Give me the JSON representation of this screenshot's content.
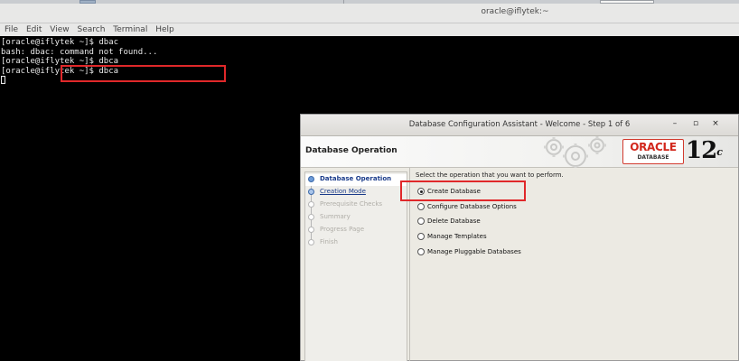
{
  "terminal": {
    "window_title": "oracle@iflytek:~",
    "menu": [
      "File",
      "Edit",
      "View",
      "Search",
      "Terminal",
      "Help"
    ],
    "lines": [
      "[oracle@iflytek ~]$ dbac",
      "bash: dbac: command not found...",
      "[oracle@iflytek ~]$ dbca",
      "[oracle@iflytek ~]$ dbca"
    ]
  },
  "dialog": {
    "title": "Database Configuration Assistant - Welcome - Step 1 of 6",
    "minimize": "–",
    "maximize": "▫",
    "close": "×",
    "banner_title": "Database Operation",
    "logo": {
      "brand": "ORACLE",
      "sub": "DATABASE",
      "version": "12",
      "version_suffix": "c"
    },
    "steps": [
      {
        "label": "Database Operation",
        "state": "active"
      },
      {
        "label": "Creation Mode",
        "state": "link"
      },
      {
        "label": "Prerequisite Checks",
        "state": "disabled"
      },
      {
        "label": "Summary",
        "state": "disabled"
      },
      {
        "label": "Progress Page",
        "state": "disabled"
      },
      {
        "label": "Finish",
        "state": "disabled"
      }
    ],
    "prompt": "Select the operation that you want to perform.",
    "options": [
      {
        "label": "Create Database",
        "selected": true
      },
      {
        "label": "Configure Database Options",
        "selected": false
      },
      {
        "label": "Delete Database",
        "selected": false
      },
      {
        "label": "Manage Templates",
        "selected": false
      },
      {
        "label": "Manage Pluggable Databases",
        "selected": false
      }
    ]
  },
  "colors": {
    "highlight": "#e0282a",
    "accent": "#1a3b8a",
    "oracle_red": "#d2271c"
  }
}
